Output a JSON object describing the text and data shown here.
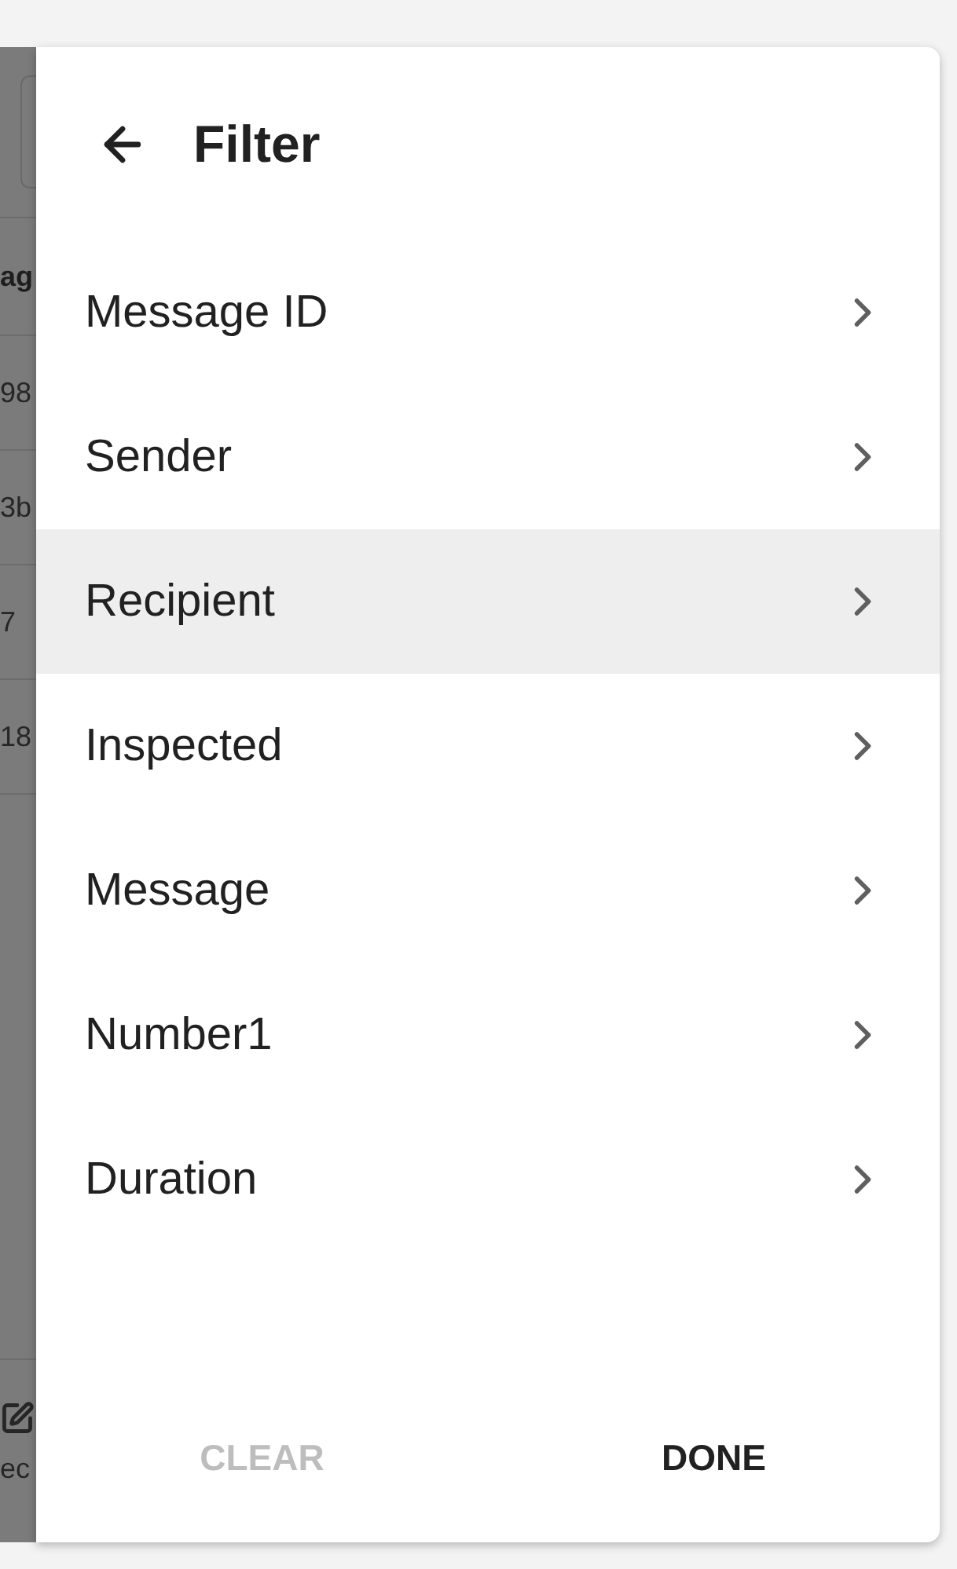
{
  "background_page": {
    "table_header": "ag",
    "table_cells": [
      "98",
      "3b",
      "7",
      "18"
    ],
    "toolbar_label": "ec"
  },
  "filter_panel": {
    "title": "Filter",
    "options": [
      {
        "label": "Message ID",
        "selected": false
      },
      {
        "label": "Sender",
        "selected": false
      },
      {
        "label": "Recipient",
        "selected": true
      },
      {
        "label": "Inspected",
        "selected": false
      },
      {
        "label": "Message",
        "selected": false
      },
      {
        "label": "Number1",
        "selected": false
      },
      {
        "label": "Duration",
        "selected": false
      }
    ],
    "buttons": [
      {
        "label": "CLEAR",
        "disabled": true
      },
      {
        "label": "DONE",
        "disabled": false
      }
    ]
  }
}
